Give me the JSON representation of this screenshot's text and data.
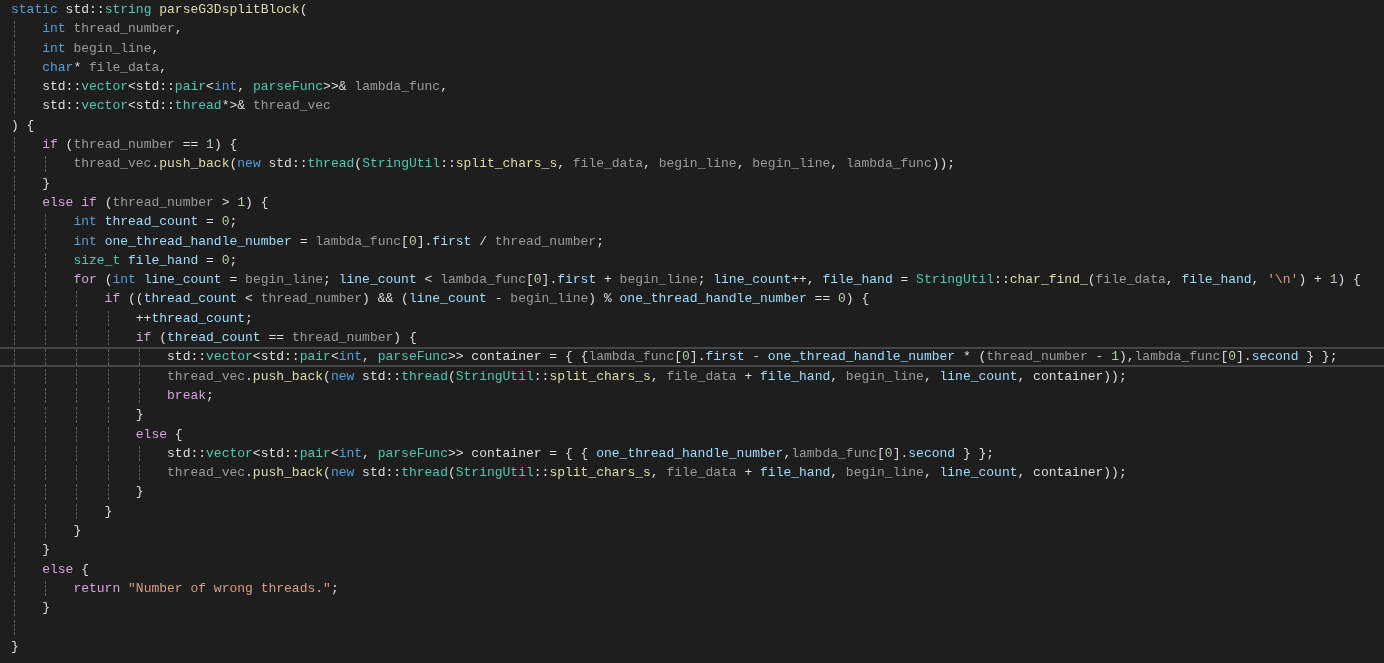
{
  "editor": {
    "lines": [
      {
        "kind": "code",
        "current": false,
        "tokens": [
          {
            "text": "static ",
            "kind": "keyword"
          },
          {
            "text": "std::",
            "kind": "plain"
          },
          {
            "text": "string ",
            "kind": "type"
          },
          {
            "text": "parseG3DsplitBlock",
            "kind": "function"
          },
          {
            "text": "(",
            "kind": "plain"
          }
        ]
      },
      {
        "kind": "code",
        "current": false,
        "tokens": [
          {
            "text": "    int ",
            "kind": "keyword"
          },
          {
            "text": "thread_number",
            "kind": "parameter"
          },
          {
            "text": ",",
            "kind": "plain"
          }
        ]
      },
      {
        "kind": "code",
        "current": false,
        "tokens": [
          {
            "text": "    int ",
            "kind": "keyword"
          },
          {
            "text": "begin_line",
            "kind": "parameter"
          },
          {
            "text": ",",
            "kind": "plain"
          }
        ]
      },
      {
        "kind": "code",
        "current": false,
        "tokens": [
          {
            "text": "    char",
            "kind": "keyword"
          },
          {
            "text": "* ",
            "kind": "plain"
          },
          {
            "text": "file_data",
            "kind": "parameter"
          },
          {
            "text": ",",
            "kind": "plain"
          }
        ]
      },
      {
        "kind": "code",
        "current": false,
        "tokens": [
          {
            "text": "    std::",
            "kind": "plain"
          },
          {
            "text": "vector",
            "kind": "type"
          },
          {
            "text": "<std::",
            "kind": "plain"
          },
          {
            "text": "pair",
            "kind": "type"
          },
          {
            "text": "<",
            "kind": "plain"
          },
          {
            "text": "int",
            "kind": "keyword"
          },
          {
            "text": ", ",
            "kind": "plain"
          },
          {
            "text": "parseFunc",
            "kind": "type"
          },
          {
            "text": ">>& ",
            "kind": "plain"
          },
          {
            "text": "lambda_func",
            "kind": "parameter"
          },
          {
            "text": ",",
            "kind": "plain"
          }
        ]
      },
      {
        "kind": "code",
        "current": false,
        "tokens": [
          {
            "text": "    std::",
            "kind": "plain"
          },
          {
            "text": "vector",
            "kind": "type"
          },
          {
            "text": "<std::",
            "kind": "plain"
          },
          {
            "text": "thread",
            "kind": "type"
          },
          {
            "text": "*>& ",
            "kind": "plain"
          },
          {
            "text": "thread_vec",
            "kind": "parameter"
          }
        ]
      },
      {
        "kind": "code",
        "current": false,
        "tokens": [
          {
            "text": ") {",
            "kind": "plain"
          }
        ]
      },
      {
        "kind": "code",
        "current": false,
        "tokens": [
          {
            "text": "    if ",
            "kind": "control"
          },
          {
            "text": "(",
            "kind": "plain"
          },
          {
            "text": "thread_number",
            "kind": "parameter"
          },
          {
            "text": " == ",
            "kind": "plain"
          },
          {
            "text": "1",
            "kind": "number"
          },
          {
            "text": ") {",
            "kind": "plain"
          }
        ]
      },
      {
        "kind": "code",
        "current": false,
        "tokens": [
          {
            "text": "        thread_vec",
            "kind": "parameter"
          },
          {
            "text": ".",
            "kind": "plain"
          },
          {
            "text": "push_back",
            "kind": "function"
          },
          {
            "text": "(",
            "kind": "plain"
          },
          {
            "text": "new ",
            "kind": "keyword"
          },
          {
            "text": "std::",
            "kind": "plain"
          },
          {
            "text": "thread",
            "kind": "type"
          },
          {
            "text": "(",
            "kind": "plain"
          },
          {
            "text": "StringUtil",
            "kind": "type"
          },
          {
            "text": "::",
            "kind": "plain"
          },
          {
            "text": "split_chars_s",
            "kind": "function"
          },
          {
            "text": ", ",
            "kind": "plain"
          },
          {
            "text": "file_data",
            "kind": "parameter"
          },
          {
            "text": ", ",
            "kind": "plain"
          },
          {
            "text": "begin_line",
            "kind": "parameter"
          },
          {
            "text": ", ",
            "kind": "plain"
          },
          {
            "text": "begin_line",
            "kind": "parameter"
          },
          {
            "text": ", ",
            "kind": "plain"
          },
          {
            "text": "lambda_func",
            "kind": "parameter"
          },
          {
            "text": "));",
            "kind": "plain"
          }
        ]
      },
      {
        "kind": "code",
        "current": false,
        "tokens": [
          {
            "text": "    }",
            "kind": "plain"
          }
        ]
      },
      {
        "kind": "code",
        "current": false,
        "tokens": [
          {
            "text": "    else if ",
            "kind": "control"
          },
          {
            "text": "(",
            "kind": "plain"
          },
          {
            "text": "thread_number",
            "kind": "parameter"
          },
          {
            "text": " > ",
            "kind": "plain"
          },
          {
            "text": "1",
            "kind": "number"
          },
          {
            "text": ") {",
            "kind": "plain"
          }
        ]
      },
      {
        "kind": "code",
        "current": false,
        "tokens": [
          {
            "text": "        int ",
            "kind": "keyword"
          },
          {
            "text": "thread_count",
            "kind": "local"
          },
          {
            "text": " = ",
            "kind": "plain"
          },
          {
            "text": "0",
            "kind": "number"
          },
          {
            "text": ";",
            "kind": "plain"
          }
        ]
      },
      {
        "kind": "code",
        "current": false,
        "tokens": [
          {
            "text": "        int ",
            "kind": "keyword"
          },
          {
            "text": "one_thread_handle_number",
            "kind": "local"
          },
          {
            "text": " = ",
            "kind": "plain"
          },
          {
            "text": "lambda_func",
            "kind": "parameter"
          },
          {
            "text": "[",
            "kind": "plain"
          },
          {
            "text": "0",
            "kind": "number"
          },
          {
            "text": "].",
            "kind": "plain"
          },
          {
            "text": "first",
            "kind": "local"
          },
          {
            "text": " / ",
            "kind": "plain"
          },
          {
            "text": "thread_number",
            "kind": "parameter"
          },
          {
            "text": ";",
            "kind": "plain"
          }
        ]
      },
      {
        "kind": "code",
        "current": false,
        "tokens": [
          {
            "text": "        size_t ",
            "kind": "type"
          },
          {
            "text": "file_hand",
            "kind": "local"
          },
          {
            "text": " = ",
            "kind": "plain"
          },
          {
            "text": "0",
            "kind": "number"
          },
          {
            "text": ";",
            "kind": "plain"
          }
        ]
      },
      {
        "kind": "code",
        "current": false,
        "tokens": [
          {
            "text": "        for ",
            "kind": "control"
          },
          {
            "text": "(",
            "kind": "plain"
          },
          {
            "text": "int ",
            "kind": "keyword"
          },
          {
            "text": "line_count",
            "kind": "local"
          },
          {
            "text": " = ",
            "kind": "plain"
          },
          {
            "text": "begin_line",
            "kind": "parameter"
          },
          {
            "text": "; ",
            "kind": "plain"
          },
          {
            "text": "line_count",
            "kind": "local"
          },
          {
            "text": " < ",
            "kind": "plain"
          },
          {
            "text": "lambda_func",
            "kind": "parameter"
          },
          {
            "text": "[",
            "kind": "plain"
          },
          {
            "text": "0",
            "kind": "number"
          },
          {
            "text": "].",
            "kind": "plain"
          },
          {
            "text": "first",
            "kind": "local"
          },
          {
            "text": " + ",
            "kind": "plain"
          },
          {
            "text": "begin_line",
            "kind": "parameter"
          },
          {
            "text": "; ",
            "kind": "plain"
          },
          {
            "text": "line_count",
            "kind": "local"
          },
          {
            "text": "++, ",
            "kind": "plain"
          },
          {
            "text": "file_hand",
            "kind": "local"
          },
          {
            "text": " = ",
            "kind": "plain"
          },
          {
            "text": "StringUtil",
            "kind": "type"
          },
          {
            "text": "::",
            "kind": "plain"
          },
          {
            "text": "char_find_",
            "kind": "function"
          },
          {
            "text": "(",
            "kind": "plain"
          },
          {
            "text": "file_data",
            "kind": "parameter"
          },
          {
            "text": ", ",
            "kind": "plain"
          },
          {
            "text": "file_hand",
            "kind": "local"
          },
          {
            "text": ", ",
            "kind": "plain"
          },
          {
            "text": "'\\n'",
            "kind": "string"
          },
          {
            "text": ") + ",
            "kind": "plain"
          },
          {
            "text": "1",
            "kind": "number"
          },
          {
            "text": ") {",
            "kind": "plain"
          }
        ]
      },
      {
        "kind": "code",
        "current": false,
        "tokens": [
          {
            "text": "            if ",
            "kind": "control"
          },
          {
            "text": "((",
            "kind": "plain"
          },
          {
            "text": "thread_count",
            "kind": "local"
          },
          {
            "text": " < ",
            "kind": "plain"
          },
          {
            "text": "thread_number",
            "kind": "parameter"
          },
          {
            "text": ") && (",
            "kind": "plain"
          },
          {
            "text": "line_count",
            "kind": "local"
          },
          {
            "text": " - ",
            "kind": "plain"
          },
          {
            "text": "begin_line",
            "kind": "parameter"
          },
          {
            "text": ") % ",
            "kind": "plain"
          },
          {
            "text": "one_thread_handle_number",
            "kind": "local"
          },
          {
            "text": " == ",
            "kind": "plain"
          },
          {
            "text": "0",
            "kind": "number"
          },
          {
            "text": ") {",
            "kind": "plain"
          }
        ]
      },
      {
        "kind": "code",
        "current": false,
        "tokens": [
          {
            "text": "                ++",
            "kind": "plain"
          },
          {
            "text": "thread_count",
            "kind": "local"
          },
          {
            "text": ";",
            "kind": "plain"
          }
        ]
      },
      {
        "kind": "code",
        "current": false,
        "tokens": [
          {
            "text": "                if ",
            "kind": "control"
          },
          {
            "text": "(",
            "kind": "plain"
          },
          {
            "text": "thread_count",
            "kind": "local"
          },
          {
            "text": " == ",
            "kind": "plain"
          },
          {
            "text": "thread_number",
            "kind": "parameter"
          },
          {
            "text": ") {",
            "kind": "plain"
          }
        ]
      },
      {
        "kind": "code",
        "current": true,
        "tokens": [
          {
            "text": "                    std::",
            "kind": "plain"
          },
          {
            "text": "vector",
            "kind": "type"
          },
          {
            "text": "<std::",
            "kind": "plain"
          },
          {
            "text": "pair",
            "kind": "type"
          },
          {
            "text": "<",
            "kind": "plain"
          },
          {
            "text": "int",
            "kind": "keyword"
          },
          {
            "text": ", ",
            "kind": "plain"
          },
          {
            "text": "parseFunc",
            "kind": "type"
          },
          {
            "text": ">> container = { {",
            "kind": "plain"
          },
          {
            "text": "lambda_func",
            "kind": "parameter"
          },
          {
            "text": "[",
            "kind": "plain"
          },
          {
            "text": "0",
            "kind": "number"
          },
          {
            "text": "].",
            "kind": "plain"
          },
          {
            "text": "first",
            "kind": "local"
          },
          {
            "text": " - ",
            "kind": "plain"
          },
          {
            "text": "one_thread_handle_number",
            "kind": "local"
          },
          {
            "text": " * (",
            "kind": "plain"
          },
          {
            "text": "thread_number",
            "kind": "parameter"
          },
          {
            "text": " - ",
            "kind": "plain"
          },
          {
            "text": "1",
            "kind": "number"
          },
          {
            "text": "),",
            "kind": "plain"
          },
          {
            "text": "lambda_func",
            "kind": "parameter"
          },
          {
            "text": "[",
            "kind": "plain"
          },
          {
            "text": "0",
            "kind": "number"
          },
          {
            "text": "].",
            "kind": "plain"
          },
          {
            "text": "second",
            "kind": "local"
          },
          {
            "text": " } };",
            "kind": "plain"
          }
        ]
      },
      {
        "kind": "code",
        "current": false,
        "tokens": [
          {
            "text": "                    thread_vec",
            "kind": "parameter"
          },
          {
            "text": ".",
            "kind": "plain"
          },
          {
            "text": "push_back",
            "kind": "function"
          },
          {
            "text": "(",
            "kind": "plain"
          },
          {
            "text": "new ",
            "kind": "keyword"
          },
          {
            "text": "std::",
            "kind": "plain"
          },
          {
            "text": "thread",
            "kind": "type"
          },
          {
            "text": "(",
            "kind": "plain"
          },
          {
            "text": "StringUtil",
            "kind": "type"
          },
          {
            "text": "::",
            "kind": "plain"
          },
          {
            "text": "split_chars_s",
            "kind": "function"
          },
          {
            "text": ", ",
            "kind": "plain"
          },
          {
            "text": "file_data",
            "kind": "parameter"
          },
          {
            "text": " + ",
            "kind": "plain"
          },
          {
            "text": "file_hand",
            "kind": "local"
          },
          {
            "text": ", ",
            "kind": "plain"
          },
          {
            "text": "begin_line",
            "kind": "parameter"
          },
          {
            "text": ", ",
            "kind": "plain"
          },
          {
            "text": "line_count",
            "kind": "local"
          },
          {
            "text": ", container));",
            "kind": "plain"
          }
        ]
      },
      {
        "kind": "code",
        "current": false,
        "tokens": [
          {
            "text": "                    break",
            "kind": "control"
          },
          {
            "text": ";",
            "kind": "plain"
          }
        ]
      },
      {
        "kind": "code",
        "current": false,
        "tokens": [
          {
            "text": "                }",
            "kind": "plain"
          }
        ]
      },
      {
        "kind": "code",
        "current": false,
        "tokens": [
          {
            "text": "                else ",
            "kind": "control"
          },
          {
            "text": "{",
            "kind": "plain"
          }
        ]
      },
      {
        "kind": "code",
        "current": false,
        "tokens": [
          {
            "text": "                    std::",
            "kind": "plain"
          },
          {
            "text": "vector",
            "kind": "type"
          },
          {
            "text": "<std::",
            "kind": "plain"
          },
          {
            "text": "pair",
            "kind": "type"
          },
          {
            "text": "<",
            "kind": "plain"
          },
          {
            "text": "int",
            "kind": "keyword"
          },
          {
            "text": ", ",
            "kind": "plain"
          },
          {
            "text": "parseFunc",
            "kind": "type"
          },
          {
            "text": ">> container = { { ",
            "kind": "plain"
          },
          {
            "text": "one_thread_handle_number",
            "kind": "local"
          },
          {
            "text": ",",
            "kind": "plain"
          },
          {
            "text": "lambda_func",
            "kind": "parameter"
          },
          {
            "text": "[",
            "kind": "plain"
          },
          {
            "text": "0",
            "kind": "number"
          },
          {
            "text": "].",
            "kind": "plain"
          },
          {
            "text": "second",
            "kind": "local"
          },
          {
            "text": " } };",
            "kind": "plain"
          }
        ]
      },
      {
        "kind": "code",
        "current": false,
        "tokens": [
          {
            "text": "                    thread_vec",
            "kind": "parameter"
          },
          {
            "text": ".",
            "kind": "plain"
          },
          {
            "text": "push_back",
            "kind": "function"
          },
          {
            "text": "(",
            "kind": "plain"
          },
          {
            "text": "new ",
            "kind": "keyword"
          },
          {
            "text": "std::",
            "kind": "plain"
          },
          {
            "text": "thread",
            "kind": "type"
          },
          {
            "text": "(",
            "kind": "plain"
          },
          {
            "text": "StringUtil",
            "kind": "type"
          },
          {
            "text": "::",
            "kind": "plain"
          },
          {
            "text": "split_chars_s",
            "kind": "function"
          },
          {
            "text": ", ",
            "kind": "plain"
          },
          {
            "text": "file_data",
            "kind": "parameter"
          },
          {
            "text": " + ",
            "kind": "plain"
          },
          {
            "text": "file_hand",
            "kind": "local"
          },
          {
            "text": ", ",
            "kind": "plain"
          },
          {
            "text": "begin_line",
            "kind": "parameter"
          },
          {
            "text": ", ",
            "kind": "plain"
          },
          {
            "text": "line_count",
            "kind": "local"
          },
          {
            "text": ", container));",
            "kind": "plain"
          }
        ]
      },
      {
        "kind": "code",
        "current": false,
        "tokens": [
          {
            "text": "                }",
            "kind": "plain"
          }
        ]
      },
      {
        "kind": "code",
        "current": false,
        "tokens": [
          {
            "text": "            }",
            "kind": "plain"
          }
        ]
      },
      {
        "kind": "code",
        "current": false,
        "tokens": [
          {
            "text": "        }",
            "kind": "plain"
          }
        ]
      },
      {
        "kind": "code",
        "current": false,
        "tokens": [
          {
            "text": "    }",
            "kind": "plain"
          }
        ]
      },
      {
        "kind": "code",
        "current": false,
        "tokens": [
          {
            "text": "    else ",
            "kind": "control"
          },
          {
            "text": "{",
            "kind": "plain"
          }
        ]
      },
      {
        "kind": "code",
        "current": false,
        "tokens": [
          {
            "text": "        return ",
            "kind": "control"
          },
          {
            "text": "\"Number of wrong threads.\"",
            "kind": "string"
          },
          {
            "text": ";",
            "kind": "plain"
          }
        ]
      },
      {
        "kind": "code",
        "current": false,
        "tokens": [
          {
            "text": "    }",
            "kind": "plain"
          }
        ]
      },
      {
        "kind": "blank",
        "current": false
      },
      {
        "kind": "code",
        "current": false,
        "tokens": [
          {
            "text": "}",
            "kind": "plain"
          }
        ]
      }
    ]
  }
}
